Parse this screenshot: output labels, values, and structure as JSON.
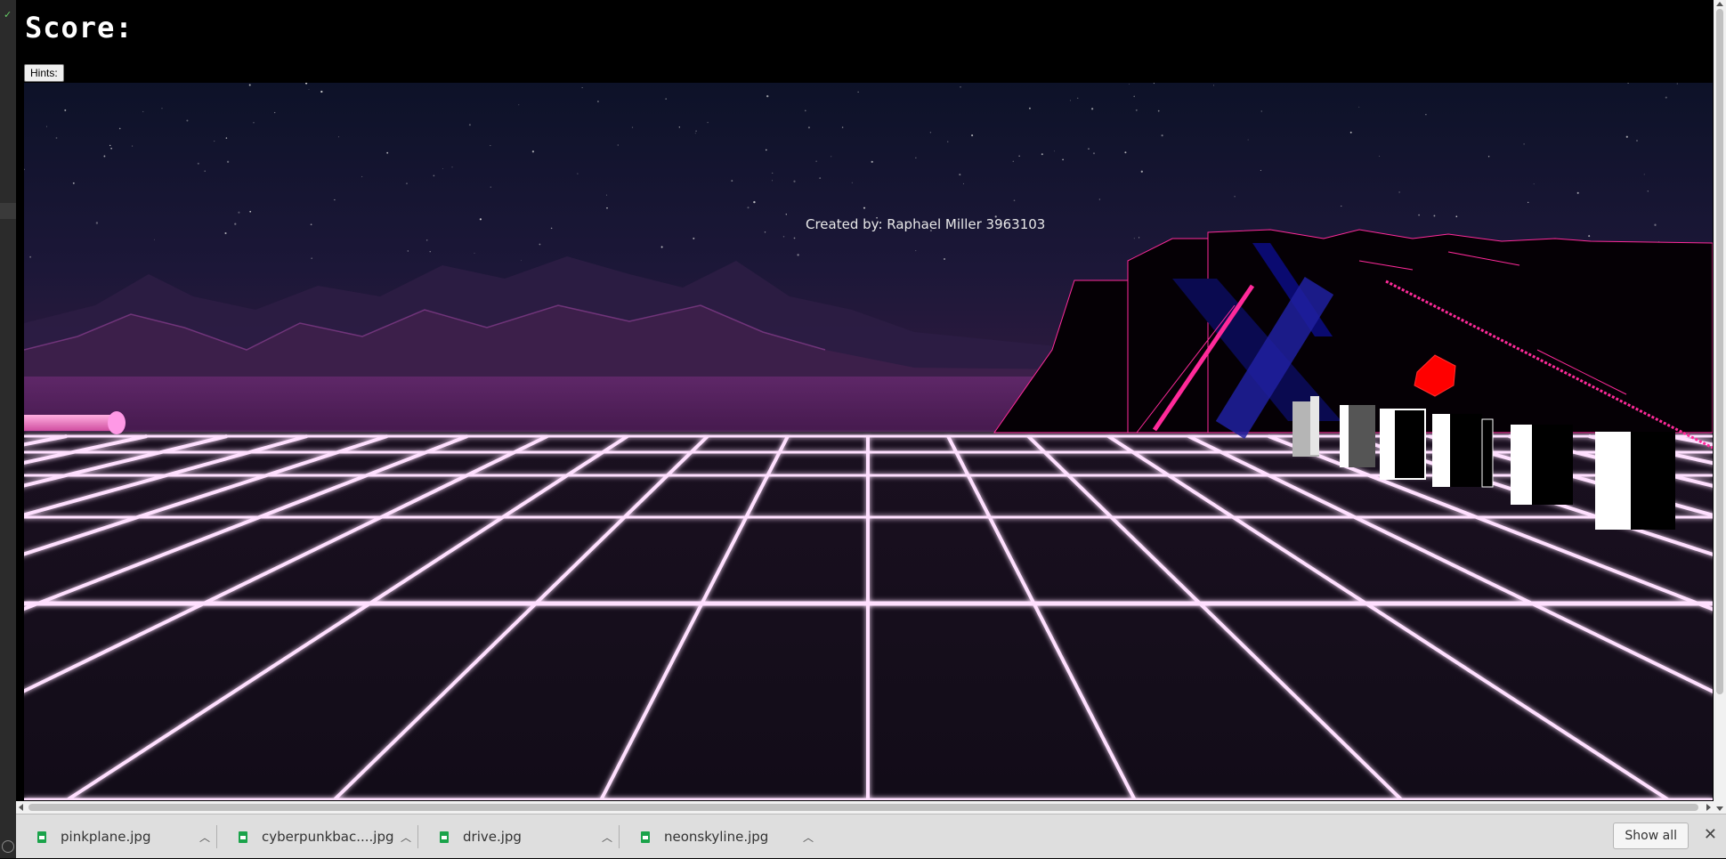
{
  "game": {
    "score_label": "Score:",
    "hints_button": "Hints:",
    "credit": "Created by: Raphael Miller 3963103"
  },
  "downloads": {
    "items": [
      {
        "name": "pinkplane.jpg"
      },
      {
        "name": "cyberpunkbac....jpg"
      },
      {
        "name": "drive.jpg"
      },
      {
        "name": "neonskyline.jpg"
      }
    ],
    "show_all": "Show all"
  },
  "colors": {
    "sky_top": "#0d1228",
    "sky_bottom": "#2a1638",
    "grid_glow": "#ffe0ff",
    "mountain": "#3c1f4a",
    "neon_pink": "#ff2a9a",
    "enemy_red": "#ff0000"
  }
}
